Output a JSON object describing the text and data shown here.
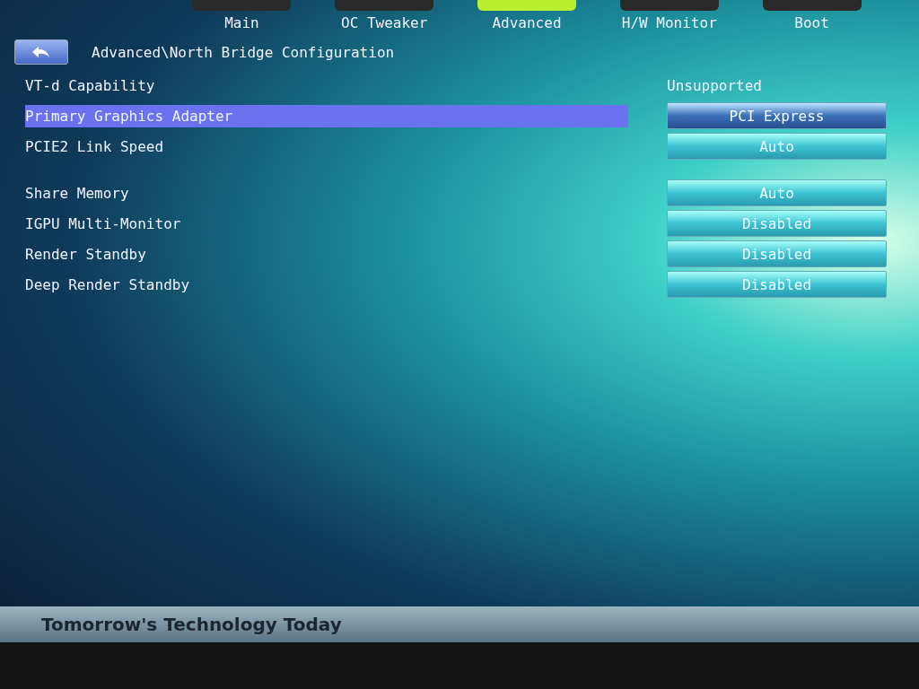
{
  "tabs": [
    {
      "label": "Main",
      "selected": false
    },
    {
      "label": "OC Tweaker",
      "selected": false
    },
    {
      "label": "Advanced",
      "selected": true
    },
    {
      "label": "H/W Monitor",
      "selected": false
    },
    {
      "label": "Boot",
      "selected": false
    }
  ],
  "breadcrumb": "Advanced\\North Bridge Configuration",
  "groups": [
    [
      {
        "label": "VT-d Capability",
        "kind": "info",
        "value": "Unsupported",
        "selected": false
      },
      {
        "label": "Primary Graphics Adapter",
        "kind": "option",
        "value": "PCI Express",
        "selected": true
      },
      {
        "label": "PCIE2 Link Speed",
        "kind": "option",
        "value": "Auto",
        "selected": false
      }
    ],
    [
      {
        "label": "Share Memory",
        "kind": "option",
        "value": "Auto",
        "selected": false
      },
      {
        "label": "IGPU Multi-Monitor",
        "kind": "option",
        "value": "Disabled",
        "selected": false
      },
      {
        "label": "Render Standby",
        "kind": "option",
        "value": "Disabled",
        "selected": false
      },
      {
        "label": "Deep Render Standby",
        "kind": "option",
        "value": "Disabled",
        "selected": false
      }
    ]
  ],
  "footer": "Tomorrow's Technology Today"
}
